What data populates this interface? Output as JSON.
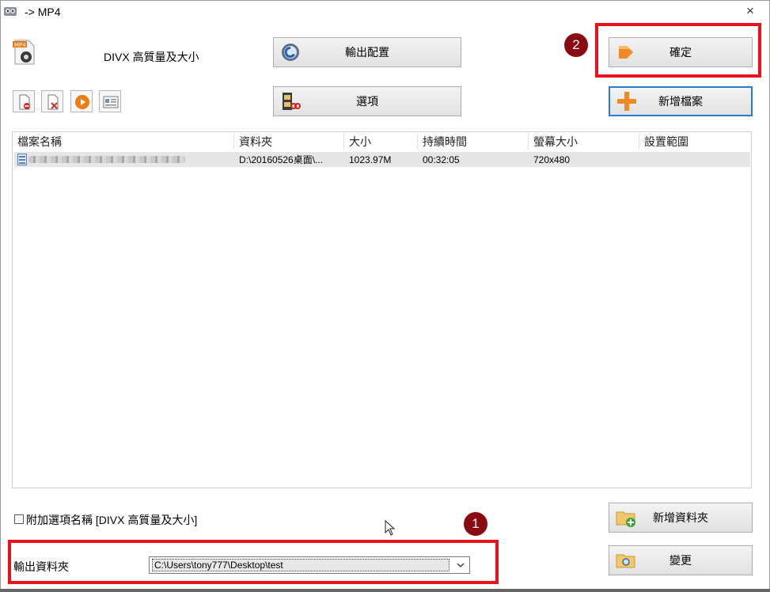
{
  "window": {
    "title": "-> MP4",
    "close_glyph": "×"
  },
  "format": {
    "label": "DIVX 高質量及大小",
    "icon": "mp4-file-icon"
  },
  "buttons": {
    "output_config": "輸出配置",
    "options": "選項",
    "ok": "確定",
    "add_file": "新增檔案",
    "add_folder": "新增資料夾",
    "change": "變更"
  },
  "toolbar_icons": [
    "remove-file-icon",
    "clear-list-icon",
    "play-icon",
    "info-icon"
  ],
  "table": {
    "columns": [
      "檔案名稱",
      "資料夾",
      "大小",
      "持續時間",
      "螢幕大小",
      "設置範圍"
    ],
    "rows": [
      {
        "folder": "D:\\20160526桌面\\...",
        "size": "1023.97M",
        "duration": "00:32:05",
        "screen": "720x480",
        "range": ""
      }
    ]
  },
  "append_option": {
    "label": "附加選項名稱 [DIVX 高質量及大小]",
    "checked": false
  },
  "output_folder": {
    "label": "輸出資料夾",
    "value": "C:\\Users\\tony777\\Desktop\\test"
  },
  "annotations": {
    "badge1": "1",
    "badge2": "2"
  },
  "colors": {
    "highlight": "#e8121d",
    "badge": "#8b0a12",
    "focus": "#2a7bd4"
  }
}
